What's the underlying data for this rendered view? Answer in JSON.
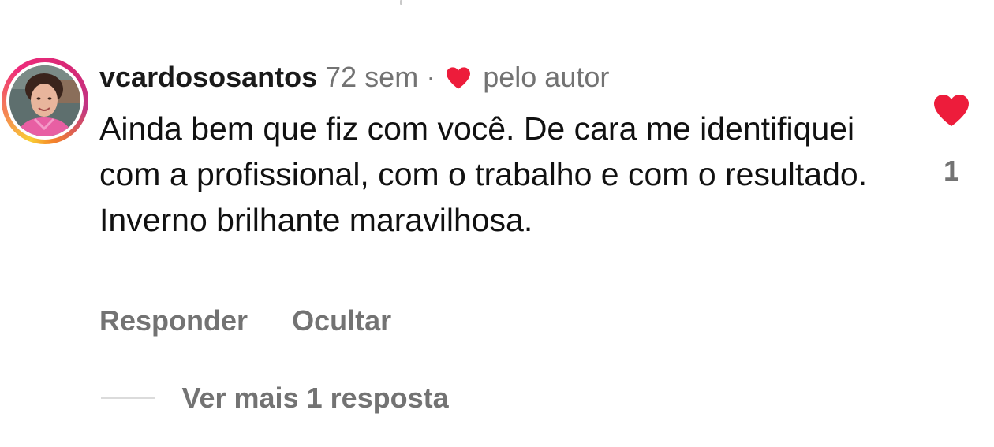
{
  "comment": {
    "username": "vcardososantos",
    "time": "72 sem",
    "separator": "·",
    "author_label": "pelo autor",
    "text": "Ainda bem que fiz com você.  De cara me identifiquei com a profissional, com o trabalho e com o resultado.  Inverno brilhante maravilhosa.",
    "like_count": "1",
    "actions": {
      "reply_label": "Responder",
      "hide_label": "Ocultar"
    },
    "view_more_replies": "Ver mais 1 resposta"
  },
  "colors": {
    "heart": "#ed1c3b",
    "secondary_text": "#737373",
    "primary_text": "#111111"
  },
  "icons": {
    "author_liked": "heart-icon",
    "like": "heart-icon",
    "avatar": "user-photo"
  }
}
